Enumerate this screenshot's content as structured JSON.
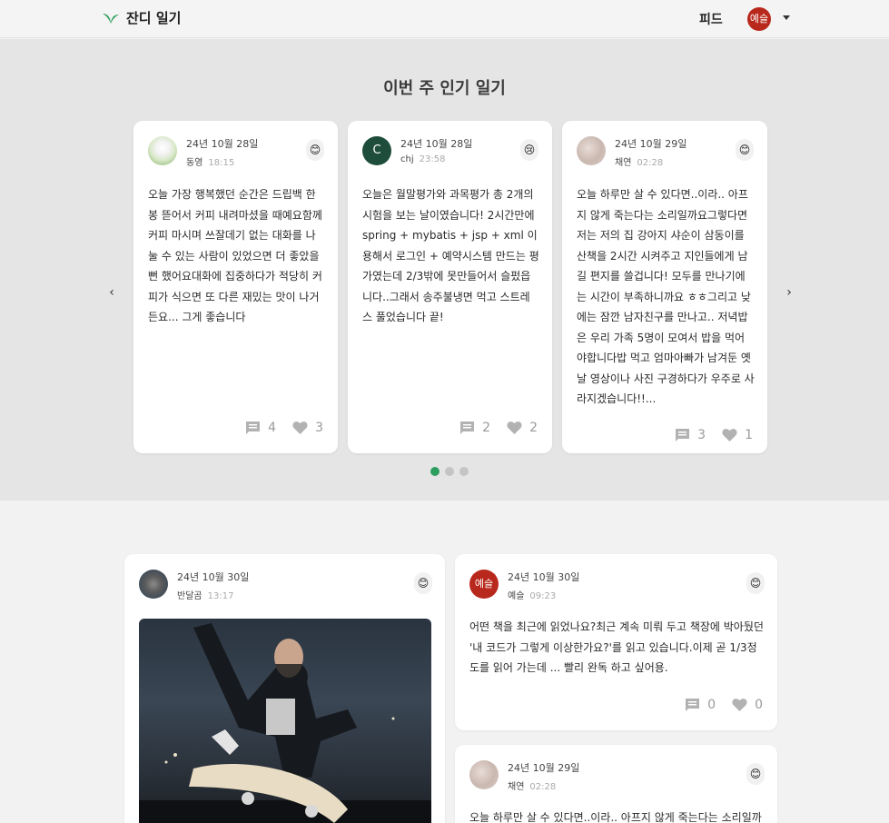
{
  "header": {
    "logo_text": "잔디 일기",
    "feed_label": "피드",
    "user_avatar_text": "예슬"
  },
  "popular": {
    "title": "이번 주 인기 일기",
    "cards": [
      {
        "date": "24년 10월 28일",
        "author": "동영",
        "time": "18:15",
        "mood": "😊",
        "text": "오늘 가장 행복했던 순간은 드립백 한 봉 뜯어서 커피 내려마셨을 때예요함께 커피 마시며 쓰잘데기 없는 대화를 나눌 수 있는 사람이 있었으면 더 좋았을 뻔 했어요대화에 집중하다가 적당히 커피가 식으면 또 다른 재밌는 맛이 나거든요... 그게 좋습니다",
        "comments": "4",
        "likes": "3"
      },
      {
        "date": "24년 10월 28일",
        "author": "chj",
        "avatar_text": "C",
        "time": "23:58",
        "mood": "😢",
        "text": "오늘은 월말평가와 과목평가 총 2개의 시험을 보는 날이였습니다! 2시간만에 spring + mybatis + jsp + xml 이용해서 로그인 + 예약시스템 만드는 평가였는데 2/3밖에 못만들어서 슬펐읍니다..그래서 송주불냉면 먹고 스트레스 풀었습니다 끝!",
        "comments": "2",
        "likes": "2"
      },
      {
        "date": "24년 10월 29일",
        "author": "채연",
        "time": "02:28",
        "mood": "😊",
        "text": "오늘 하루만 살 수 있다면..이라.. 아프지 않게 죽는다는 소리일까요그렇다면 저는 저의 집 강아지 샤순이 삼동이를 산책을 2시간 시켜주고 지인들에게 남길 편지를 쓸겁니다! 모두를 만나기에는 시간이 부족하니까요 ㅎㅎ그리고 낮에는 잠깐 남자친구를 만나고.. 저녁밥은 우리 가족 5명이 모여서 밥을 먹어야합니다밥 먹고 엄마아빠가 남겨둔 옛날 영상이나 사진 구경하다가 우주로 사라지겠습니다!!...",
        "comments": "3",
        "likes": "1"
      }
    ]
  },
  "feed": {
    "cards": [
      {
        "date": "24년 10월 30일",
        "author": "반달곰",
        "time": "13:17",
        "mood": "😊"
      },
      {
        "date": "24년 10월 30일",
        "author": "예슬",
        "avatar_text": "예슬",
        "time": "09:23",
        "mood": "😊",
        "text": "어떤 책을 최근에 읽었나요?최근 계속 미뤄 두고 책장에 박아뒀던 '내 코드가 그렇게 이상한가요?'를 읽고 있습니다.이제 곧 1/3정도를 읽어 가는데 ... 빨리 완독 하고 싶어용.",
        "comments": "0",
        "likes": "0"
      },
      {
        "date": "24년 10월 29일",
        "author": "채연",
        "time": "02:28",
        "mood": "😊",
        "text": "오늘 하루만 살 수 있다면..이라.. 아프지 않게 죽는다는 소리일까"
      }
    ]
  },
  "colors": {
    "brand_green": "#2e9e5f",
    "avatar_red": "#b8281c",
    "hero_bg": "#e5e5e5"
  }
}
